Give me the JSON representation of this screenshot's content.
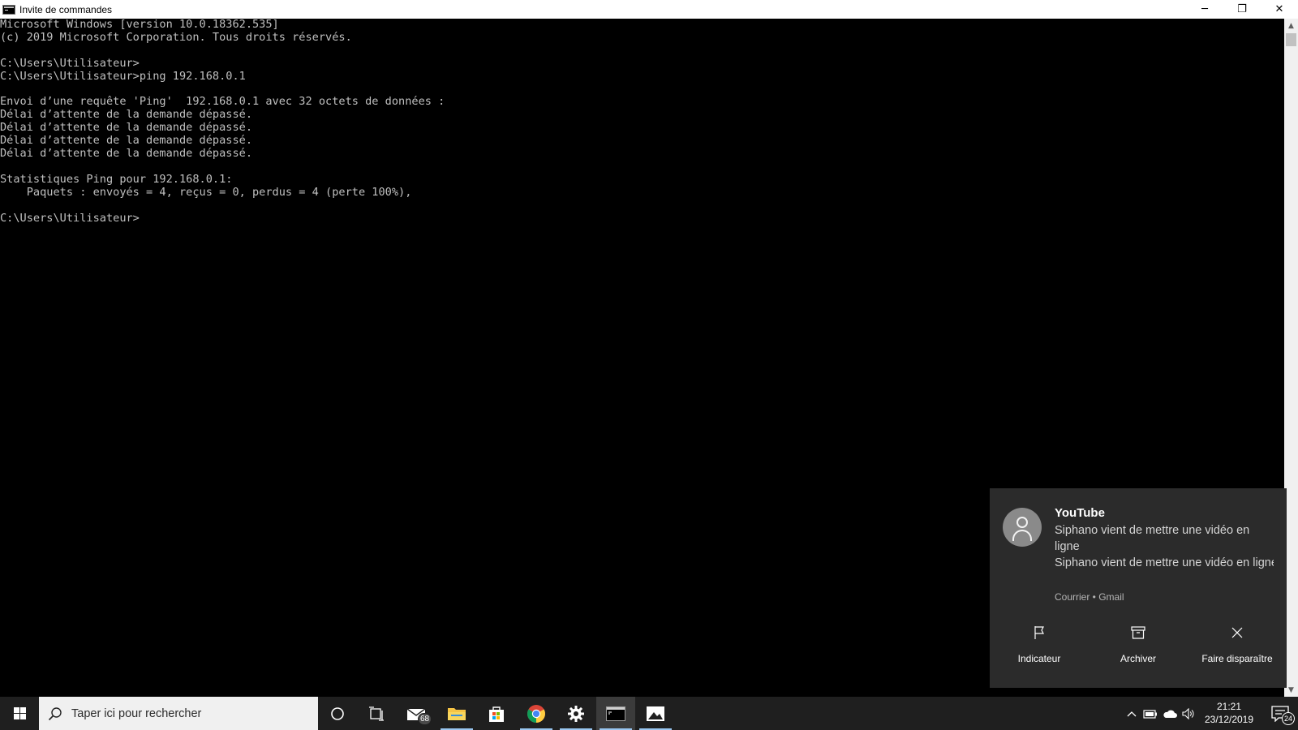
{
  "window": {
    "title": "Invite de commandes",
    "controls": {
      "minimize": "─",
      "restore": "❐",
      "close": "✕"
    }
  },
  "console": {
    "lines": [
      "Microsoft Windows [version 10.0.18362.535]",
      "(c) 2019 Microsoft Corporation. Tous droits réservés.",
      "",
      "C:\\Users\\Utilisateur>",
      "C:\\Users\\Utilisateur>ping 192.168.0.1",
      "",
      "Envoi d’une requête 'Ping'  192.168.0.1 avec 32 octets de données :",
      "Délai d’attente de la demande dépassé.",
      "Délai d’attente de la demande dépassé.",
      "Délai d’attente de la demande dépassé.",
      "Délai d’attente de la demande dépassé.",
      "",
      "Statistiques Ping pour 192.168.0.1:",
      "    Paquets : envoyés = 4, reçus = 0, perdus = 4 (perte 100%),",
      "",
      "C:\\Users\\Utilisateur>"
    ]
  },
  "notification": {
    "title": "YouTube",
    "line1": "Siphano vient de mettre une vidéo en ligne",
    "line2": "Siphano vient de mettre une vidéo en ligne Siphano a mis en ligne la vid",
    "source": "Courrier • Gmail",
    "actions": [
      {
        "label": "Indicateur",
        "icon": "flag-icon"
      },
      {
        "label": "Archiver",
        "icon": "archive-icon"
      },
      {
        "label": "Faire disparaître",
        "icon": "close-icon"
      }
    ]
  },
  "taskbar": {
    "search_placeholder": "Taper ici pour rechercher",
    "mail_badge": "68",
    "clock_time": "21:21",
    "clock_date": "23/12/2019",
    "notification_count": "24"
  }
}
